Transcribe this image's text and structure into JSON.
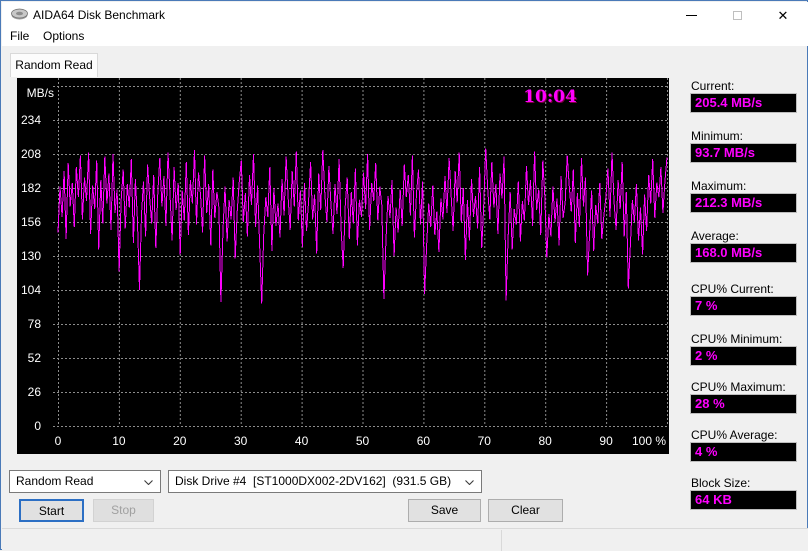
{
  "window": {
    "title": "AIDA64 Disk Benchmark"
  },
  "menu": {
    "file": "File",
    "options": "Options"
  },
  "tab": {
    "label": "Random Read"
  },
  "chart_data": {
    "type": "line",
    "clock": "10:04",
    "ylabel": "MB/s",
    "yticks": [
      234,
      208,
      182,
      156,
      130,
      104,
      78,
      52,
      26,
      0
    ],
    "xtick_step": 10,
    "xticks": [
      "0",
      "10",
      "20",
      "30",
      "40",
      "50",
      "60",
      "70",
      "80",
      "90",
      "100 %"
    ],
    "ylim": [
      0,
      260
    ],
    "xlim": [
      0,
      100
    ],
    "grid": true,
    "line_color": "#ff00ff",
    "values": [
      148,
      183,
      160,
      195,
      143,
      201,
      168,
      186,
      152,
      198,
      175,
      207,
      158,
      190,
      172,
      209,
      147,
      184,
      166,
      203,
      135,
      188,
      155,
      206,
      170,
      193,
      150,
      208,
      163,
      181,
      118,
      172,
      196,
      151,
      185,
      167,
      204,
      140,
      189,
      158,
      104,
      162,
      187,
      145,
      200,
      174,
      155,
      192,
      136,
      178,
      205,
      168,
      191,
      153,
      209,
      177,
      142,
      198,
      165,
      186,
      131,
      180,
      157,
      202,
      146,
      188,
      170,
      211,
      154,
      194,
      176,
      148,
      207,
      163,
      185,
      138,
      196,
      159,
      179,
      167,
      95,
      150,
      183,
      141,
      173,
      158,
      190,
      128,
      164,
      187,
      203,
      156,
      178,
      145,
      192,
      169,
      208,
      152,
      184,
      139,
      93.7,
      146,
      175,
      160,
      198,
      134,
      182,
      153,
      170,
      144,
      189,
      161,
      206,
      174,
      150,
      195,
      168,
      210,
      157,
      180,
      137,
      186,
      149,
      171,
      202,
      158,
      177,
      132,
      193,
      165,
      211,
      178,
      156,
      199,
      170,
      147,
      185,
      162,
      204,
      151,
      121,
      168,
      190,
      143,
      179,
      155,
      197,
      138,
      173,
      160,
      194,
      166,
      208,
      150,
      186,
      172,
      201,
      157,
      183,
      169,
      97,
      141,
      176,
      159,
      188,
      130,
      167,
      148,
      181,
      153,
      200,
      175,
      192,
      161,
      207,
      144,
      178,
      196,
      154,
      187,
      101,
      139,
      170,
      152,
      184,
      146,
      164,
      133,
      174,
      158,
      191,
      163,
      205,
      177,
      149,
      195,
      171,
      209,
      156,
      182,
      127,
      173,
      142,
      189,
      160,
      176,
      151,
      198,
      136,
      168,
      212.3,
      180,
      158,
      202,
      167,
      185,
      147,
      193,
      174,
      206,
      96,
      144,
      179,
      135,
      166,
      154,
      187,
      141,
      172,
      157,
      199,
      169,
      188,
      153,
      210,
      165,
      181,
      146,
      203,
      176,
      129,
      162,
      145,
      183,
      156,
      174,
      138,
      191,
      159,
      171,
      207,
      184,
      164,
      196,
      140,
      178,
      152,
      205,
      168,
      190,
      115,
      147,
      180,
      134,
      169,
      155,
      186,
      143,
      161,
      175,
      197,
      160,
      209,
      172,
      150,
      188,
      166,
      202,
      145,
      179,
      105,
      137,
      173,
      156,
      185,
      142,
      167,
      131,
      177,
      149,
      192,
      170,
      204,
      159,
      186,
      175,
      198,
      163,
      188,
      205.4
    ]
  },
  "stats": [
    {
      "label": "Current:",
      "value": "205.4 MB/s"
    },
    {
      "label": "Minimum:",
      "value": "93.7 MB/s"
    },
    {
      "label": "Maximum:",
      "value": "212.3 MB/s"
    },
    {
      "label": "Average:",
      "value": "168.0 MB/s"
    },
    {
      "label": "CPU% Current:",
      "value": "7 %"
    },
    {
      "label": "CPU% Minimum:",
      "value": "2 %"
    },
    {
      "label": "CPU% Maximum:",
      "value": "28 %"
    },
    {
      "label": "CPU% Average:",
      "value": "4 %"
    },
    {
      "label": "Block Size:",
      "value": "64 KB"
    }
  ],
  "controls": {
    "benchmark_select": "Random Read",
    "drive_select": "Disk Drive #4  [ST1000DX002-2DV162]  (931.5 GB)",
    "start": "Start",
    "stop": "Stop",
    "save": "Save",
    "clear": "Clear"
  },
  "colors": {
    "line": "#ff00ff",
    "grid": "#8c8c8c",
    "chart_bg": "#000000",
    "value_text": "#ff00ff"
  }
}
